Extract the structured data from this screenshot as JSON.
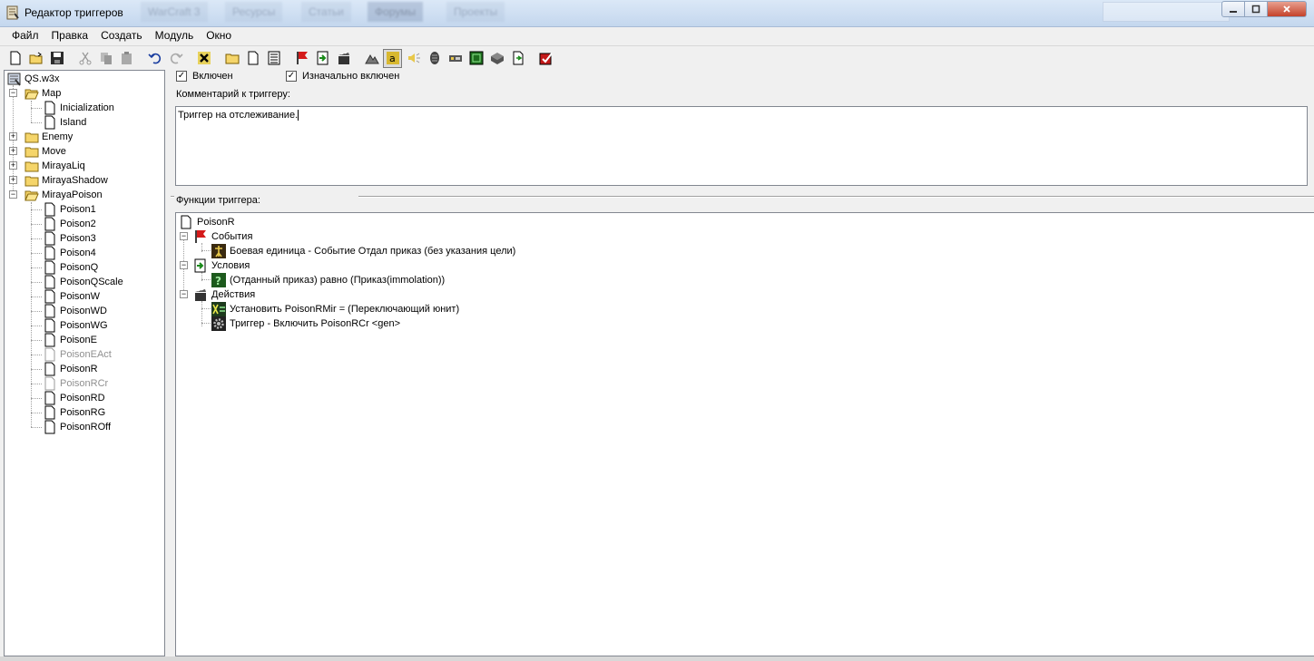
{
  "window": {
    "title": "Редактор триггеров",
    "background_tabs": [
      "WarCraft 3",
      "Ресурсы",
      "Статьи",
      "Форумы",
      "Проекты"
    ]
  },
  "menu": [
    "Файл",
    "Правка",
    "Создать",
    "Модуль",
    "Окно"
  ],
  "toolbar": {
    "buttons": [
      "new-icon",
      "open-icon",
      "save-icon",
      "cut-icon",
      "copy-icon",
      "paste-icon",
      "undo-icon",
      "redo-icon",
      "delete-icon",
      "new-category-icon",
      "new-trigger-icon",
      "new-comment-icon",
      "new-event-icon",
      "new-condition-icon",
      "new-action-icon",
      "terrain-icon",
      "object-icon",
      "sound-icon",
      "ai-icon",
      "camera-icon",
      "region-icon",
      "unit-icon",
      "import-icon",
      "test-map-icon"
    ]
  },
  "tree": {
    "root": "QS.w3x",
    "items": [
      {
        "label": "Map",
        "type": "folder",
        "expanded": true,
        "level": 1
      },
      {
        "label": "Inicialization",
        "type": "trigger",
        "level": 2
      },
      {
        "label": "Island",
        "type": "trigger",
        "level": 2
      },
      {
        "label": "Enemy",
        "type": "folder",
        "expanded": false,
        "level": 1
      },
      {
        "label": "Move",
        "type": "folder",
        "expanded": false,
        "level": 1
      },
      {
        "label": "MirayaLiq",
        "type": "folder",
        "expanded": false,
        "level": 1
      },
      {
        "label": "MirayaShadow",
        "type": "folder",
        "expanded": false,
        "level": 1
      },
      {
        "label": "MirayaPoison",
        "type": "folder",
        "expanded": true,
        "level": 1
      },
      {
        "label": "Poison1",
        "type": "trigger",
        "level": 2
      },
      {
        "label": "Poison2",
        "type": "trigger",
        "level": 2
      },
      {
        "label": "Poison3",
        "type": "trigger",
        "level": 2
      },
      {
        "label": "Poison4",
        "type": "trigger",
        "level": 2
      },
      {
        "label": "PoisonQ",
        "type": "trigger",
        "level": 2
      },
      {
        "label": "PoisonQScale",
        "type": "trigger",
        "level": 2
      },
      {
        "label": "PoisonW",
        "type": "trigger",
        "level": 2
      },
      {
        "label": "PoisonWD",
        "type": "trigger",
        "level": 2
      },
      {
        "label": "PoisonWG",
        "type": "trigger",
        "level": 2
      },
      {
        "label": "PoisonE",
        "type": "trigger",
        "level": 2
      },
      {
        "label": "PoisonEAct",
        "type": "trigger",
        "level": 2,
        "disabled": true
      },
      {
        "label": "PoisonR",
        "type": "trigger",
        "level": 2
      },
      {
        "label": "PoisonRCr",
        "type": "trigger",
        "level": 2,
        "disabled": true
      },
      {
        "label": "PoisonRD",
        "type": "trigger",
        "level": 2
      },
      {
        "label": "PoisonRG",
        "type": "trigger",
        "level": 2
      },
      {
        "label": "PoisonROff",
        "type": "trigger",
        "level": 2
      }
    ]
  },
  "trigger": {
    "enabled_label": "Включен",
    "enabled": true,
    "initially_on_label": "Изначально включен",
    "initially_on": true,
    "comment_label": "Комментарий к триггеру:",
    "comment": "Триггер на отслеживание.",
    "functions_label": "Функции триггера:",
    "name": "PoisonR",
    "events_label": "События",
    "events": [
      "Боевая единица - Событие Отдал приказ (без указания цели)"
    ],
    "conditions_label": "Условия",
    "conditions": [
      "(Отданный приказ) равно (Приказ(immolation))"
    ],
    "actions_label": "Действия",
    "actions": [
      "Установить PoisonRMir = (Переключающий юнит)",
      "Триггер - Включить PoisonRCr <gen>"
    ]
  }
}
